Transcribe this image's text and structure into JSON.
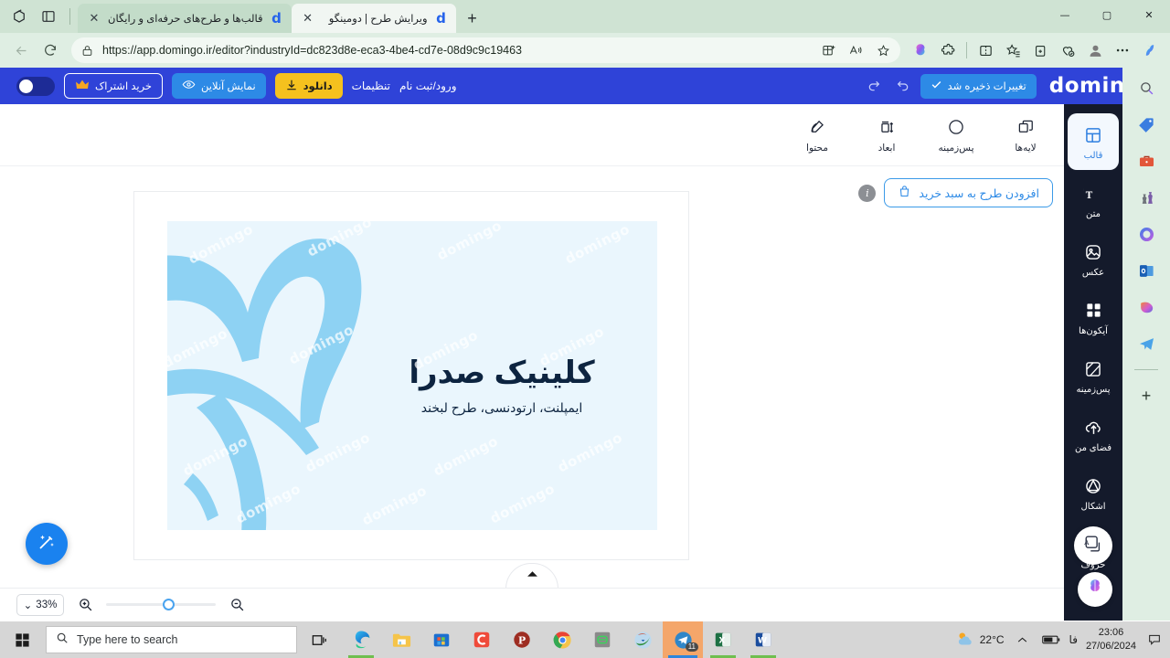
{
  "browser": {
    "tabs": [
      {
        "title": "قالب‌ها و طرح‌های حرفه‌ای و رایگان",
        "favicon": "d",
        "state": "inactive"
      },
      {
        "title": "ویرایش طرح | دومینگو",
        "favicon": "d",
        "state": "active"
      }
    ],
    "new_tab_label": "+",
    "window_controls": {
      "minimize": "—",
      "maximize": "▢",
      "close": "✕"
    },
    "url": "https://app.domingo.ir/editor?industryId=dc823d8e-eca3-4be4-cd7e-08d9c9c19463",
    "toolbar_icons": [
      "copilot-brain-icon",
      "extensions-icon",
      "split-screen-icon",
      "favorites-icon",
      "collections-icon",
      "browser-essentials-icon",
      "profile-icon",
      "settings-more-icon",
      "copilot-icon"
    ],
    "nav_icons": [
      "back-icon",
      "refresh-icon",
      "lock-icon",
      "app-available-icon",
      "read-aloud-icon",
      "favorite-star-icon"
    ]
  },
  "app_header": {
    "logo": "domingo",
    "saved_label": "تغییرات ذخیره شد",
    "undo_label": "بازگشت",
    "redo_label": "جلو",
    "subscription_label": "خرید اشتراک",
    "preview_label": "نمایش آنلاین",
    "download_label": "دانلود",
    "settings_label": "تنظیمات",
    "account_label": "ورود/ثبت نام",
    "accent_blue": "#2f43d8",
    "accent_yellow": "#f5c11e",
    "accent_cyan": "#2d8ae6"
  },
  "subtoolbar": {
    "items": [
      {
        "label": "لایه‌ها",
        "icon": "layers-icon"
      },
      {
        "label": "پس‌زمینه",
        "icon": "circle-background-icon"
      },
      {
        "label": "ابعاد",
        "icon": "dimensions-icon"
      },
      {
        "label": "محتوا",
        "icon": "content-edit-icon"
      }
    ]
  },
  "workspace": {
    "cart_button": "افزودن طرح به سبد خرید",
    "cart_icon": "shopping-bag-icon",
    "info_icon": "i",
    "magic_button": "magic-wand-icon",
    "collapse_handle": "chevron-up-icon",
    "design": {
      "title": "کلینیک صدرا",
      "subtitle": "ایمپلنت، ارتودنسی، طرح لبخند",
      "watermark": "domingo",
      "background_color": "#eaf6fd",
      "graphic_color": "#8ed2f3",
      "text_color": "#0d2440"
    }
  },
  "zoombar": {
    "zoom_level": "33%",
    "chevron": "⌄",
    "zoom_in_icon": "zoom-in-icon",
    "zoom_out_icon": "zoom-out-icon"
  },
  "side_rail": {
    "items": [
      {
        "label": "قالب",
        "icon": "template-icon",
        "active": true
      },
      {
        "label": "متن",
        "icon": "text-icon",
        "active": false
      },
      {
        "label": "عکس",
        "icon": "image-icon",
        "active": false
      },
      {
        "label": "آیکون‌ها",
        "icon": "grid-icons-icon",
        "active": false
      },
      {
        "label": "پس‌زمینه",
        "icon": "background-icon",
        "active": false
      },
      {
        "label": "فضای من",
        "icon": "cloud-upload-icon",
        "active": false
      },
      {
        "label": "اشکال",
        "icon": "shapes-icon",
        "active": false
      },
      {
        "label": "حروف",
        "icon": "fonts-icon",
        "active": false
      }
    ],
    "background": "#141a2b"
  },
  "edge_sidebar": {
    "items": [
      "search-icon",
      "deals-tag-icon",
      "tools-briefcase-icon",
      "games-icon",
      "office-icon",
      "outlook-icon",
      "designer-icon",
      "telegram-icon"
    ],
    "add_label": "+"
  },
  "taskbar": {
    "start_icon": "windows-start-icon",
    "search_placeholder": "Type here to search",
    "search_icon": "search-icon",
    "task_view_icon": "task-view-icon",
    "apps": [
      {
        "name": "edge-icon",
        "state": "running"
      },
      {
        "name": "file-explorer-icon",
        "state": "idle"
      },
      {
        "name": "microsoft-store-icon",
        "state": "idle"
      },
      {
        "name": "camtasia-icon",
        "state": "idle"
      },
      {
        "name": "p-app-icon",
        "state": "idle"
      },
      {
        "name": "chrome-icon",
        "state": "idle"
      },
      {
        "name": "green-app-icon",
        "state": "idle"
      },
      {
        "name": "idm-icon",
        "state": "idle"
      },
      {
        "name": "telegram-icon",
        "state": "active",
        "badge": "11"
      },
      {
        "name": "excel-icon",
        "state": "running"
      },
      {
        "name": "word-icon",
        "state": "running"
      }
    ],
    "weather_temp": "22°C",
    "weather_icon": "partly-sunny-icon",
    "show_hidden_icon": "chevron-up-icon",
    "battery_icon": "battery-icon",
    "language": "فا",
    "clock_time": "23:06",
    "clock_date": "27/06/2024",
    "notification_icon": "notification-icon"
  }
}
